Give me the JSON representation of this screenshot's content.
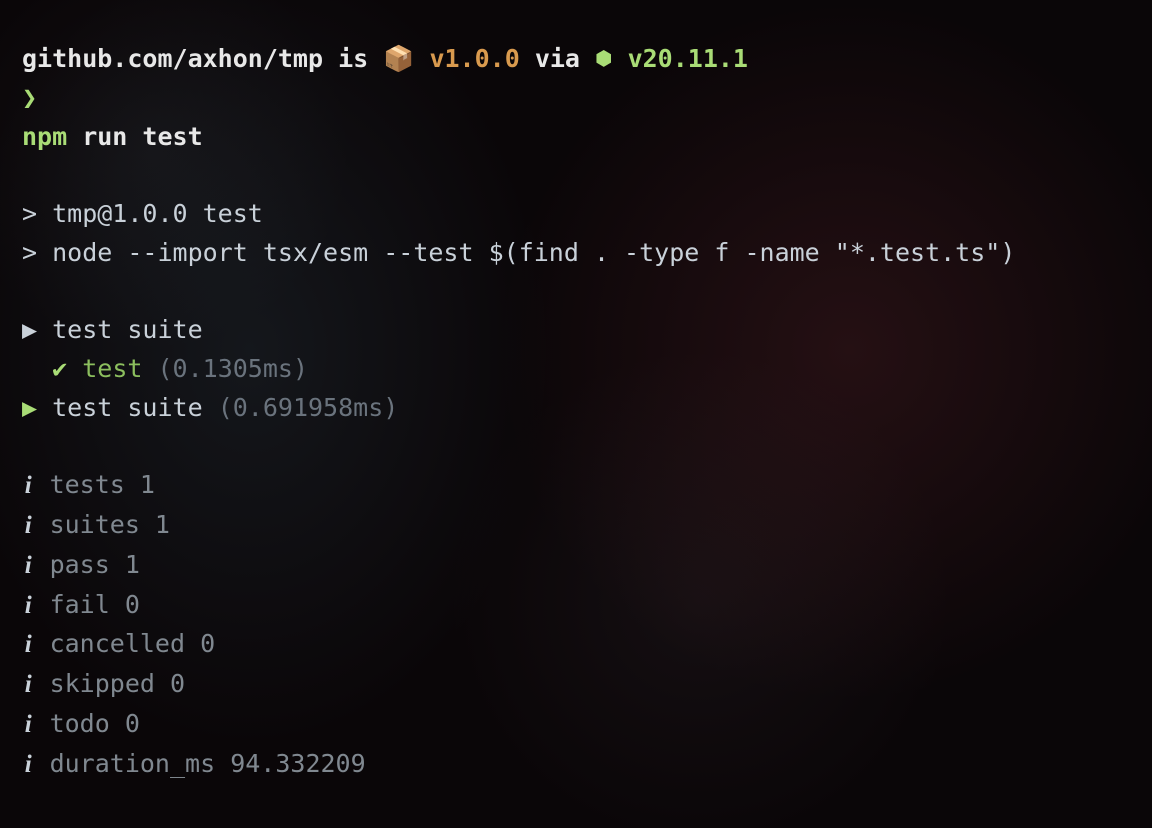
{
  "prompt": {
    "repo_path": "github.com/axhon/tmp",
    "is_text": " is ",
    "package_icon": "📦",
    "package_version": "v1.0.0",
    "via_text": " via ",
    "node_icon": "⬢",
    "node_version": "v20.11.1",
    "prompt_char": "❯"
  },
  "command": {
    "cmd_part1": "npm",
    "cmd_part2": " run test"
  },
  "npm_output": {
    "line1": "> tmp@1.0.0 test",
    "line2": "> node --import tsx/esm --test $(find . -type f -name \"*.test.ts\")"
  },
  "test_tree": {
    "suite1": {
      "marker": "▶",
      "name": "test suite"
    },
    "test1": {
      "indent": "  ",
      "marker": "✔",
      "name": " test",
      "duration": " (0.1305ms)"
    },
    "suite2": {
      "marker": "▶",
      "name": "test suite",
      "duration": " (0.691958ms)"
    }
  },
  "summary": [
    {
      "label": "tests",
      "value": "1"
    },
    {
      "label": "suites",
      "value": "1"
    },
    {
      "label": "pass",
      "value": "1"
    },
    {
      "label": "fail",
      "value": "0"
    },
    {
      "label": "cancelled",
      "value": "0"
    },
    {
      "label": "skipped",
      "value": "0"
    },
    {
      "label": "todo",
      "value": "0"
    },
    {
      "label": "duration_ms",
      "value": "94.332209"
    }
  ],
  "info_char": "i"
}
